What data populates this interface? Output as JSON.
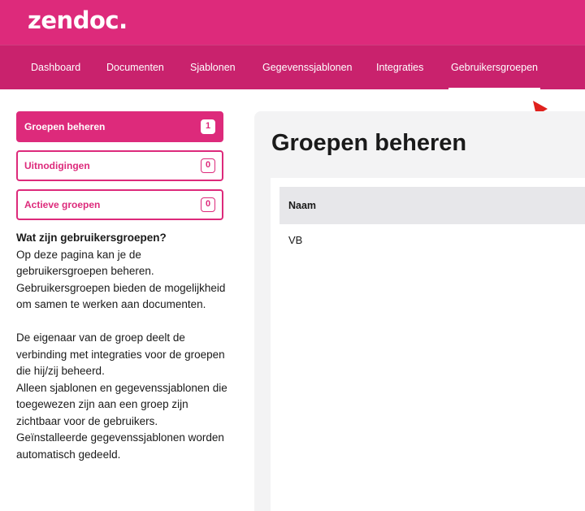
{
  "brand": {
    "logo_text": "zendoc.",
    "primary_color": "#dd2a7b",
    "nav_color": "#c9226d"
  },
  "nav": {
    "items": [
      {
        "label": "Dashboard"
      },
      {
        "label": "Documenten"
      },
      {
        "label": "Sjablonen"
      },
      {
        "label": "Gegevenssjablonen"
      },
      {
        "label": "Integraties"
      },
      {
        "label": "Gebruikersgroepen",
        "active": true
      }
    ]
  },
  "sidebar": {
    "buttons": [
      {
        "label": "Groepen beheren",
        "count": "1",
        "active": true
      },
      {
        "label": "Uitnodigingen",
        "count": "0"
      },
      {
        "label": "Actieve groepen",
        "count": "0"
      }
    ],
    "info": {
      "title": "Wat zijn gebruikersgroepen?",
      "paragraph1": "Op deze pagina kan je de gebruikersgroepen beheren. Gebruikersgroepen bieden de mogelijkheid om samen te werken aan documenten.",
      "paragraph2a": "De eigenaar van de groep deelt de verbinding met integraties voor de groepen die hij/zij beheerd.",
      "paragraph2b": "Alleen sjablonen en gegevenssjablonen die toegewezen zijn aan een groep zijn zichtbaar voor de gebruikers.",
      "paragraph2c": "Geïnstalleerde gegevenssjablonen worden automatisch gedeeld."
    }
  },
  "main": {
    "title": "Groepen beheren",
    "table": {
      "columns": [
        "Naam"
      ],
      "rows": [
        {
          "naam": "VB"
        }
      ]
    }
  },
  "annotation": {
    "icon": "red-arrow-icon",
    "color": "#e0211d"
  }
}
